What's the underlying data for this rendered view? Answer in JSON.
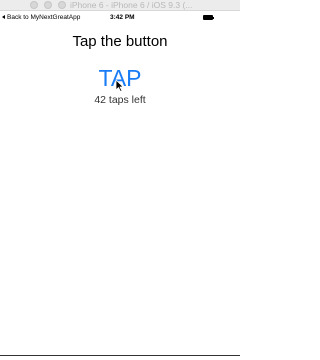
{
  "window": {
    "title": "iPhone 6 - iPhone 6 / iOS 9.3 (..."
  },
  "status_bar": {
    "back_label": "Back to MyNextGreatApp",
    "time": "3:42 PM"
  },
  "main": {
    "headline": "Tap the button",
    "tap_button_label": "TAP",
    "taps_left": "42 taps left"
  },
  "icons": {
    "back": "back-arrow-icon",
    "battery": "battery-icon",
    "cursor": "mouse-pointer-icon"
  },
  "colors": {
    "accent": "#1a7cf5",
    "text": "#000000",
    "secondary_text": "#333333"
  }
}
